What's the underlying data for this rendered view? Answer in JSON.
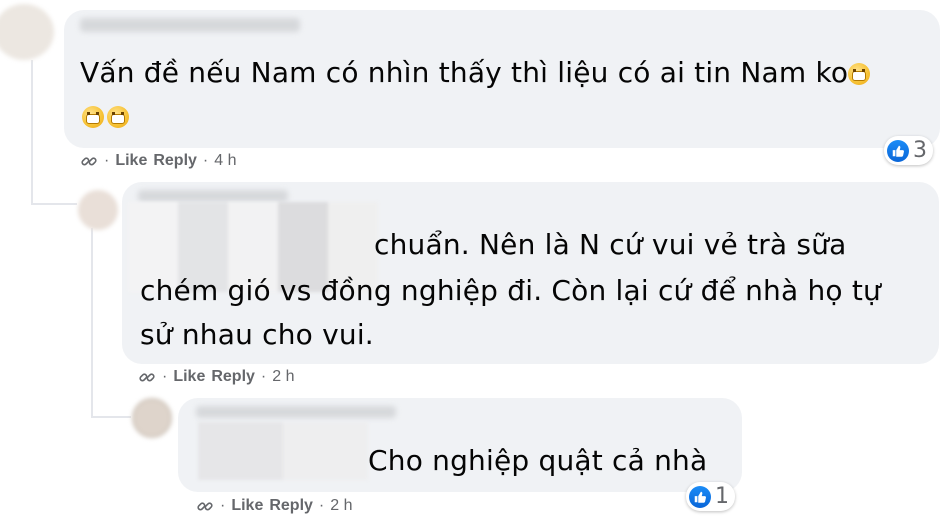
{
  "comments": [
    {
      "text_line1": "Vấn đề nếu Nam có nhìn thấy thì liệu có ai tin Nam ko",
      "actions": {
        "like": "Like",
        "reply": "Reply",
        "time": "4 h"
      },
      "reaction_count": "3"
    },
    {
      "text_line1": "chuẩn. Nên là N cứ vui vẻ trà sữa",
      "text_line2": "chém gió vs đồng nghiệp đi. Còn lại cứ để nhà họ tự",
      "text_line3": "sử nhau cho vui.",
      "actions": {
        "like": "Like",
        "reply": "Reply",
        "time": "2 h"
      }
    },
    {
      "text_line1": "Cho nghiệp quật cả nhà",
      "actions": {
        "like": "Like",
        "reply": "Reply",
        "time": "2 h"
      },
      "reaction_count": "1"
    }
  ],
  "separator": "·",
  "colors": {
    "bubble": "#f0f2f5",
    "meta": "#65676b",
    "like_blue": "#1877f2",
    "text": "#050505"
  },
  "icons": [
    "link-icon",
    "like-reaction-icon",
    "grimace-emoji-icon"
  ]
}
